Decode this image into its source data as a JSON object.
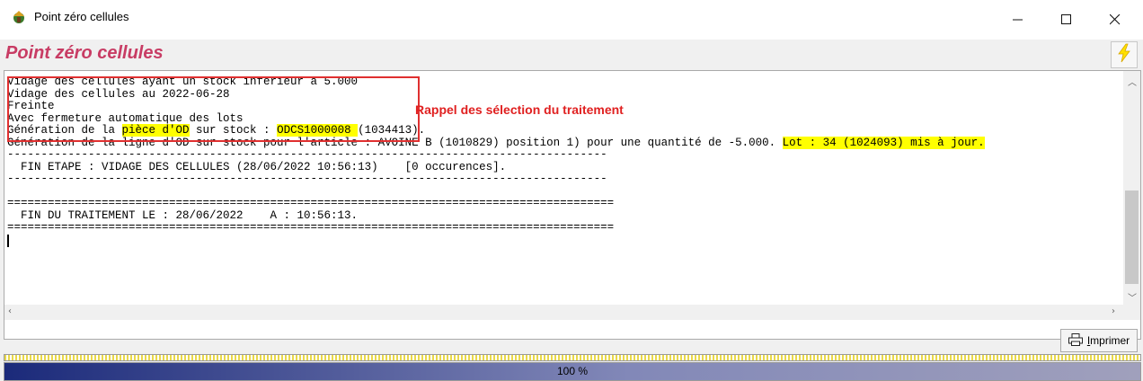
{
  "window": {
    "title": "Point zéro cellules",
    "controls": {
      "minimize": "—",
      "maximize": "☐",
      "close": "✕"
    }
  },
  "header": {
    "title": "Point zéro cellules",
    "run_icon": "lightning-icon"
  },
  "log": {
    "lines": [
      [
        "Vidage des cellules ayant un stock inférieur à 5.000"
      ],
      [
        "Vidage des cellules au 2022-06-28"
      ],
      [
        "Freinte"
      ],
      [
        "Avec fermeture automatique des lots"
      ],
      [
        "Génération de la ",
        "pièce d'OD",
        " sur stock : ",
        "ODCS1000008 ",
        "(1034413)."
      ],
      [
        "Génération de la ligne d'OD sur stock pour l'article : AVOINE B (1010829) position 1) pour une quantité de -5.000. ",
        "Lot : 34 (1024093) mis à jour."
      ],
      [
        "-----------------------------------------------------------------------------------------"
      ],
      [
        "  FIN ETAPE : VIDAGE DES CELLULES (28/06/2022 10:56:13)    [0 occurences]."
      ],
      [
        "-----------------------------------------------------------------------------------------"
      ],
      [
        ""
      ],
      [
        "=========================================================================================="
      ],
      [
        "  FIN DU TRAITEMENT LE : 28/06/2022    A : 10:56:13."
      ],
      [
        "=========================================================================================="
      ]
    ],
    "annotation": "Rappel des sélection du traitement"
  },
  "footer": {
    "print_label": "Imprimer",
    "print_icon": "printer-icon"
  },
  "progress": {
    "value": 1.0,
    "label": "100 %"
  },
  "colors": {
    "title_accent": "#c83c64",
    "annotation_red": "#e02020",
    "highlight_yellow": "#ffff00",
    "progress_start": "#1b2a7a"
  }
}
